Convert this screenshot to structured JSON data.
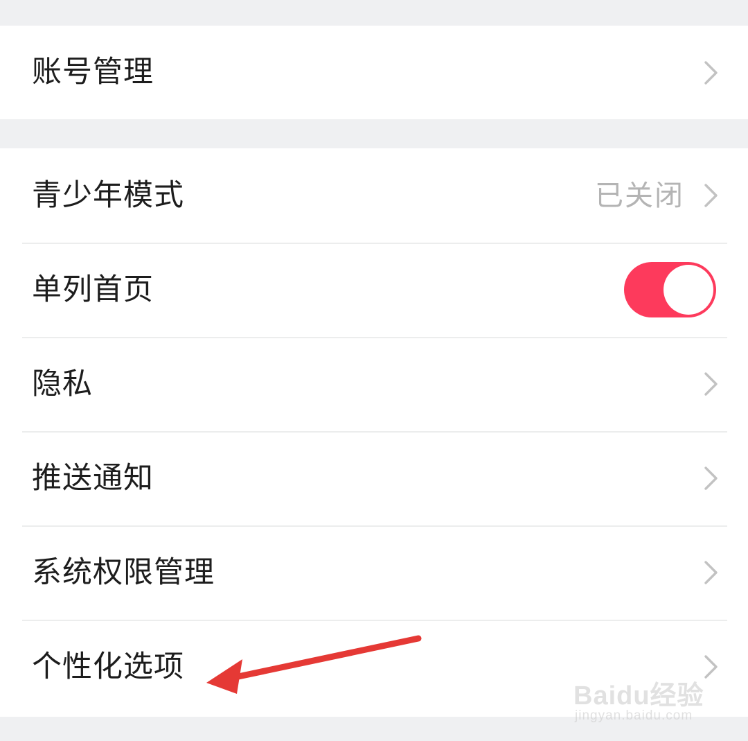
{
  "settings": {
    "account": {
      "label": "账号管理"
    },
    "items": [
      {
        "label": "青少年模式",
        "value": "已关闭",
        "control": "chevron"
      },
      {
        "label": "单列首页",
        "control": "toggle",
        "toggle_on": true
      },
      {
        "label": "隐私",
        "control": "chevron"
      },
      {
        "label": "推送通知",
        "control": "chevron"
      },
      {
        "label": "系统权限管理",
        "control": "chevron"
      },
      {
        "label": "个性化选项",
        "control": "chevron"
      }
    ]
  },
  "icons": {
    "chevron": "chevron-right-icon",
    "annotation": "red-arrow-icon"
  },
  "colors": {
    "background": "#eff0f2",
    "card": "#ffffff",
    "toggle_on": "#fd3a5c",
    "annotation_arrow": "#e53935",
    "secondary_text": "#b4b4b4"
  },
  "watermark": {
    "logo_text": "Baidu经验",
    "url": "jingyan.baidu.com"
  }
}
